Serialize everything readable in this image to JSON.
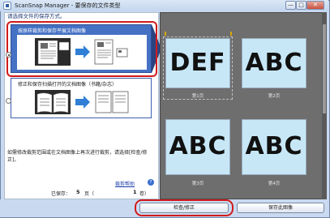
{
  "window": {
    "title": "ScanSnap Manager - 要保存的文件类型",
    "min_glyph": "—",
    "max_glyph": "□",
    "close_glyph": "✕"
  },
  "left": {
    "instruction": "请选择文件的保存方式。",
    "option1": {
      "label": "按原样裁剪和保存平展文档图像",
      "selected": true
    },
    "option2": {
      "label": "修正和保存扫描打开的文档图像（书籍/杂志）",
      "selected": false
    },
    "note": "如需修改裁剪范围或在文档图像上再次进行裁剪，请选择[检查/修正]。",
    "help_link": "裁剪帮助",
    "help_icon": "?",
    "saved_label": "已保存：",
    "saved_value": "5",
    "saved_unit": "页（",
    "volume_value": "1",
    "volume_unit": "卷）"
  },
  "thumbnails": [
    {
      "text": "DEF",
      "caption": "第1页"
    },
    {
      "text": "ABC",
      "caption": "第2页"
    },
    {
      "text": "ABC",
      "caption": "第3页"
    },
    {
      "text": "ABC",
      "caption": "第4页"
    }
  ],
  "buttons": {
    "check": "检查/修正",
    "save": "保存此图像"
  },
  "colors": {
    "accent_red": "#d11b1b",
    "option_blue": "#4571c4",
    "thumb_bg": "#c7e7f7",
    "pane_gray": "#6e6e6e"
  }
}
